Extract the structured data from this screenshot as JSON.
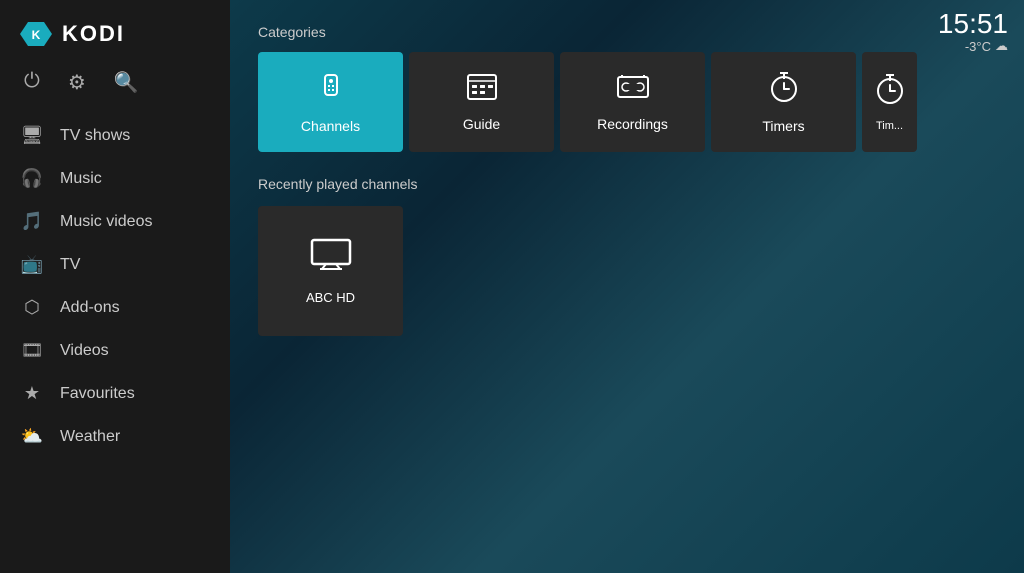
{
  "app": {
    "name": "KODI"
  },
  "clock": {
    "time": "15:51",
    "temp": "-3°C",
    "weather_icon": "☁"
  },
  "top_icons": [
    {
      "name": "power-icon",
      "symbol": "⏻"
    },
    {
      "name": "settings-icon",
      "symbol": "⚙"
    },
    {
      "name": "search-icon",
      "symbol": "🔍"
    }
  ],
  "sidebar": {
    "items": [
      {
        "id": "tv-shows",
        "label": "TV shows",
        "icon": "🖥"
      },
      {
        "id": "music",
        "label": "Music",
        "icon": "🎧"
      },
      {
        "id": "music-videos",
        "label": "Music videos",
        "icon": "🎵"
      },
      {
        "id": "tv",
        "label": "TV",
        "icon": "📺"
      },
      {
        "id": "add-ons",
        "label": "Add-ons",
        "icon": "⬡"
      },
      {
        "id": "videos",
        "label": "Videos",
        "icon": "🎞"
      },
      {
        "id": "favourites",
        "label": "Favourites",
        "icon": "★"
      },
      {
        "id": "weather",
        "label": "Weather",
        "icon": "⛅"
      }
    ]
  },
  "categories": {
    "label": "Categories",
    "items": [
      {
        "id": "channels",
        "label": "Channels",
        "icon": "📡",
        "active": true
      },
      {
        "id": "guide",
        "label": "Guide",
        "icon": "📋",
        "active": false
      },
      {
        "id": "recordings",
        "label": "Recordings",
        "icon": "📻",
        "active": false
      },
      {
        "id": "timers",
        "label": "Timers",
        "icon": "⏱",
        "active": false
      },
      {
        "id": "timers2",
        "label": "Tim...",
        "icon": "⏱",
        "active": false,
        "partial": true
      }
    ]
  },
  "recently_played": {
    "label": "Recently played channels",
    "channels": [
      {
        "id": "abc-hd",
        "label": "ABC HD",
        "icon": "🖥"
      }
    ]
  }
}
